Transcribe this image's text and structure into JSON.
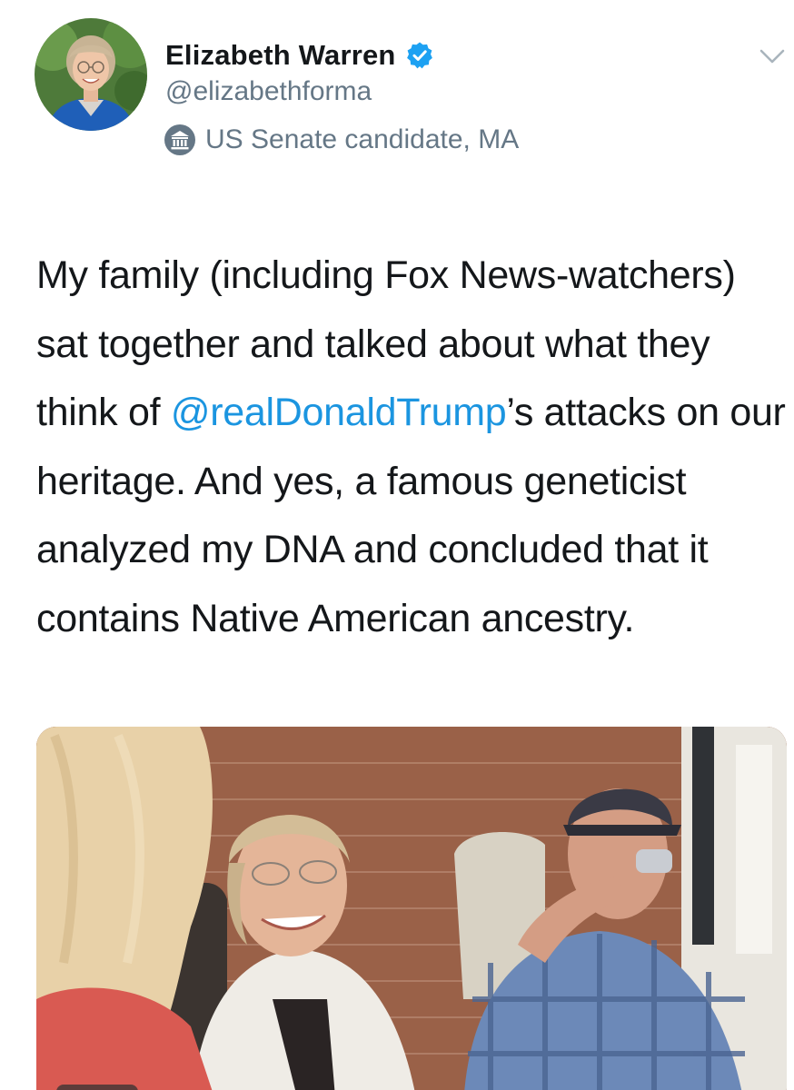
{
  "user": {
    "display_name": "Elizabeth Warren",
    "handle": "@elizabethforma",
    "label": "US Senate candidate, MA",
    "verified_icon": "verified-badge-icon",
    "label_icon": "government-building-icon"
  },
  "tweet": {
    "text_before": "My family (including Fox News-watchers) sat together and talked about what they think of ",
    "mention": "@realDonaldTrump",
    "text_after": "’s attacks on our heritage. And yes, a famous geneticist analyzed my DNA and concluded that it contains Native American ancestry."
  },
  "media": {
    "type": "video-thumbnail",
    "icon": "video-thumbnail-icon"
  },
  "menu": {
    "icon": "chevron-down-icon"
  },
  "colors": {
    "text": "#14171a",
    "secondary": "#657786",
    "link": "#1b95e0",
    "verified": "#1da1f2"
  }
}
